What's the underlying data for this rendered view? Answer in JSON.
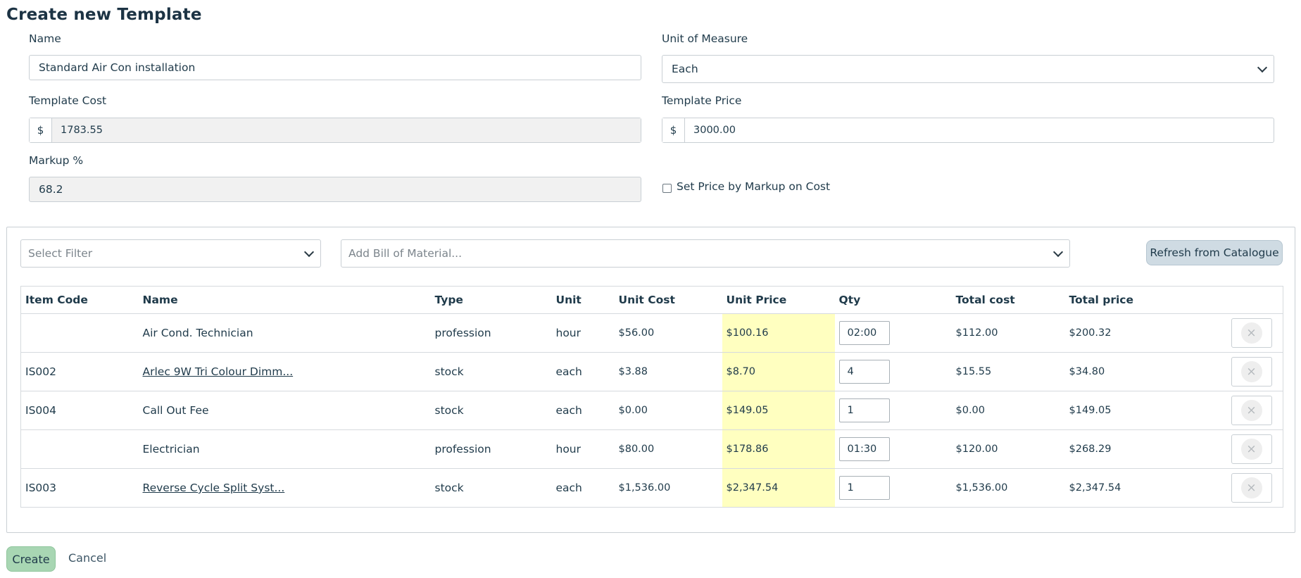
{
  "page": {
    "title": "Create new Template"
  },
  "form": {
    "name": {
      "label": "Name",
      "value": "Standard Air Con installation"
    },
    "unit_of_measure": {
      "label": "Unit of Measure",
      "value": "Each"
    },
    "template_cost": {
      "label": "Template Cost",
      "currency": "$",
      "value": "1783.55"
    },
    "template_price": {
      "label": "Template Price",
      "currency": "$",
      "value": "3000.00"
    },
    "markup": {
      "label": "Markup %",
      "value": "68.2"
    },
    "set_price_by_markup": {
      "label": "Set Price by Markup on Cost",
      "checked": false
    }
  },
  "bom": {
    "filter_placeholder": "Select Filter",
    "add_placeholder": "Add Bill of Material...",
    "refresh_label": "Refresh from Catalogue",
    "columns": [
      "Item Code",
      "Name",
      "Type",
      "Unit",
      "Unit Cost",
      "Unit Price",
      "Qty",
      "Total cost",
      "Total price"
    ],
    "rows": [
      {
        "code": "",
        "name": "Air Cond. Technician",
        "link": false,
        "type": "profession",
        "unit": "hour",
        "unit_cost": "$56.00",
        "unit_price": "$100.16",
        "qty": "02:00",
        "total_cost": "$112.00",
        "total_price": "$200.32"
      },
      {
        "code": "IS002",
        "name": "Arlec 9W Tri Colour Dimm...",
        "link": true,
        "type": "stock",
        "unit": "each",
        "unit_cost": "$3.88",
        "unit_price": "$8.70",
        "qty": "4",
        "total_cost": "$15.55",
        "total_price": "$34.80"
      },
      {
        "code": "IS004",
        "name": "Call Out Fee",
        "link": false,
        "type": "stock",
        "unit": "each",
        "unit_cost": "$0.00",
        "unit_price": "$149.05",
        "qty": "1",
        "total_cost": "$0.00",
        "total_price": "$149.05"
      },
      {
        "code": "",
        "name": "Electrician",
        "link": false,
        "type": "profession",
        "unit": "hour",
        "unit_cost": "$80.00",
        "unit_price": "$178.86",
        "qty": "01:30",
        "total_cost": "$120.00",
        "total_price": "$268.29"
      },
      {
        "code": "IS003",
        "name": "Reverse Cycle Split Syst...",
        "link": true,
        "type": "stock",
        "unit": "each",
        "unit_cost": "$1,536.00",
        "unit_price": "$2,347.54",
        "qty": "1",
        "total_cost": "$1,536.00",
        "total_price": "$2,347.54"
      }
    ],
    "delete_icon": "×"
  },
  "actions": {
    "create_label": "Create",
    "cancel_label": "Cancel"
  },
  "colors": {
    "highlight": "#ffffc0",
    "create_button": "#a8d6b3",
    "refresh_button": "#cfdbe3",
    "readonly_field": "#f1f1f1"
  }
}
